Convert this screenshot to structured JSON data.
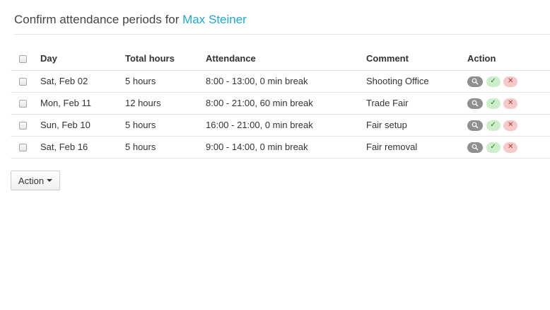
{
  "header": {
    "prefix": "Confirm attendance periods for",
    "person": "Max Steiner"
  },
  "table": {
    "columns": [
      "Day",
      "Total hours",
      "Attendance",
      "Comment",
      "Action"
    ],
    "rows": [
      {
        "day": "Sat, Feb 02",
        "hours": "5 hours",
        "attendance": "8:00 - 13:00, 0 min break",
        "comment": "Shooting Office"
      },
      {
        "day": "Mon, Feb 11",
        "hours": "12 hours",
        "attendance": "8:00 - 21:00, 60 min break",
        "comment": "Trade Fair"
      },
      {
        "day": "Sun, Feb 10",
        "hours": "5 hours",
        "attendance": "16:00 - 21:00, 0 min break",
        "comment": "Fair setup"
      },
      {
        "day": "Sat, Feb 16",
        "hours": "5 hours",
        "attendance": "9:00 - 14:00, 0 min break",
        "comment": "Fair removal"
      }
    ]
  },
  "icons": {
    "view": "search-icon",
    "approve": "check-icon",
    "reject": "close-icon"
  },
  "footer": {
    "action_label": "Action"
  },
  "colors": {
    "accent": "#19a9d5",
    "approve_bg": "#cdeecb",
    "reject_bg": "#f6c9c9",
    "view_bg": "#8f8f8f"
  }
}
